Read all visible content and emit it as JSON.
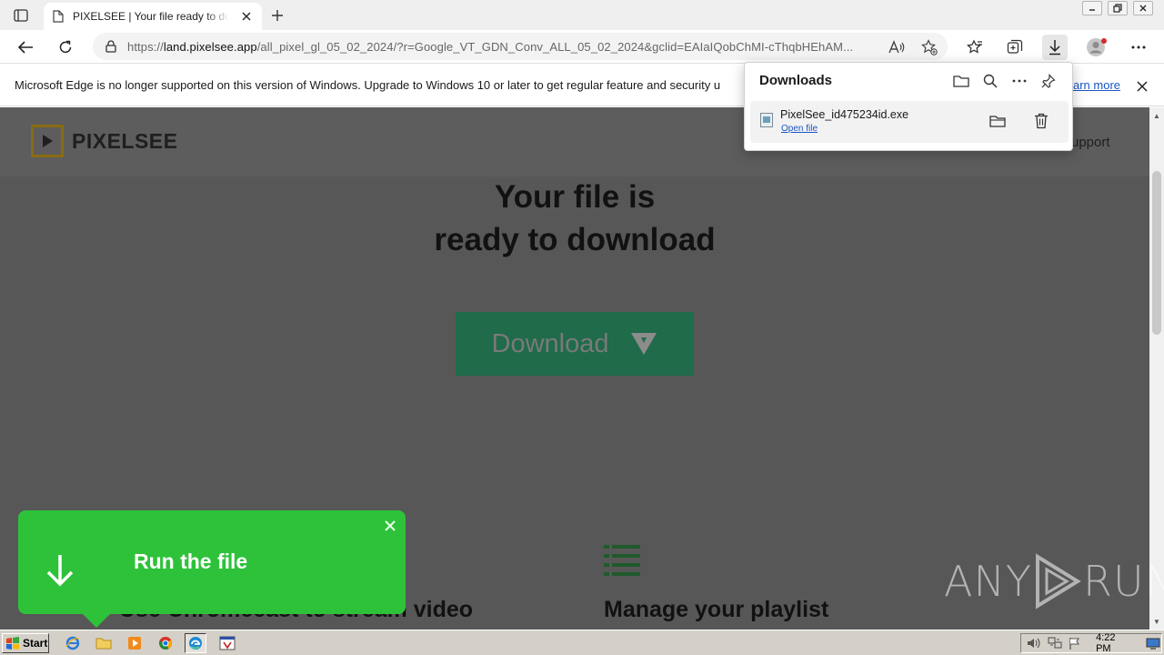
{
  "browser": {
    "tab_title": "PIXELSEE | Your file ready to download",
    "url_prefix": "https://",
    "url_host": "land.pixelsee.app",
    "url_rest": "/all_pixel_gl_05_02_2024/?r=Google_VT_GDN_Conv_ALL_05_02_2024&gclid=EAIaIQobChMI-cThqbHEhAM..."
  },
  "infobar": {
    "message": "Microsoft Edge is no longer supported on this version of Windows. Upgrade to Windows 10 or later to get regular feature and security u",
    "link": "arn more"
  },
  "downloads": {
    "title": "Downloads",
    "filename": "PixelSee_id475234id.exe",
    "open_label": "Open file"
  },
  "site": {
    "logo_text": "PIXELSEE",
    "nav_support": "upport",
    "hero_line1": "Your file is",
    "hero_line2": "ready to download",
    "download_label": "Download",
    "feature_1": "Use Chromecast to stream video",
    "feature_2": "Manage your playlist"
  },
  "toast": {
    "text": "Run the file"
  },
  "watermark": {
    "left": "ANY",
    "right": "RUN"
  },
  "taskbar": {
    "start_label": "Start",
    "clock": "4:22 PM"
  },
  "colors": {
    "download_button": "#1f6b4a",
    "toast": "#2ec23a",
    "logo_accent": "#8a6b12"
  }
}
